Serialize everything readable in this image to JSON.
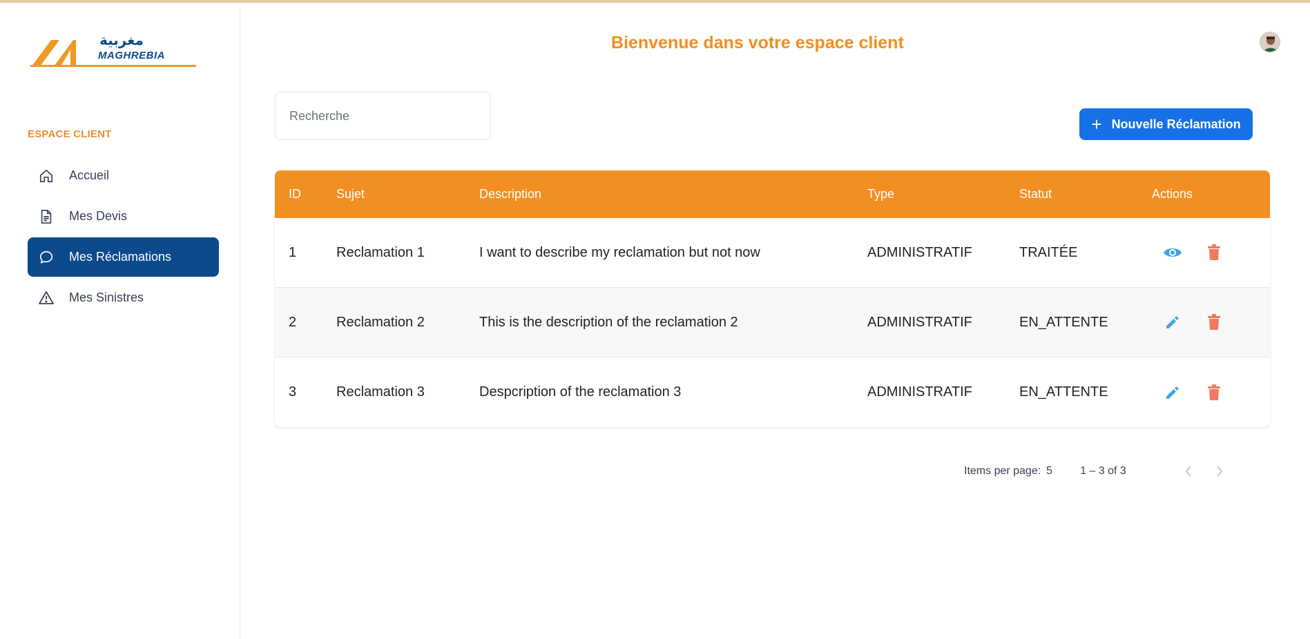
{
  "app": {
    "logo_arabic": "مغربية",
    "logo_text": "MAGHREBIA",
    "welcome": "Bienvenue dans votre espace client"
  },
  "sidebar": {
    "section_label": "ESPACE CLIENT",
    "items": [
      {
        "label": "Accueil",
        "icon": "home-icon",
        "active": false
      },
      {
        "label": "Mes Devis",
        "icon": "document-icon",
        "active": false
      },
      {
        "label": "Mes Réclamations",
        "icon": "chat-bubble-icon",
        "active": true
      },
      {
        "label": "Mes Sinistres",
        "icon": "warning-icon",
        "active": false
      }
    ]
  },
  "search": {
    "placeholder": "Recherche",
    "value": ""
  },
  "toolbar": {
    "new_label": "Nouvelle Réclamation"
  },
  "table": {
    "headers": [
      "ID",
      "Sujet",
      "Description",
      "Type",
      "Statut",
      "Actions"
    ],
    "rows": [
      {
        "id": "1",
        "sujet": "Reclamation 1",
        "description": "I want to describe my reclamation but not now",
        "type": "ADMINISTRATIF",
        "statut": "TRAITÉE",
        "primary_action": "eye-icon"
      },
      {
        "id": "2",
        "sujet": "Reclamation 2",
        "description": "This is the description of the reclamation 2",
        "type": "ADMINISTRATIF",
        "statut": "EN_ATTENTE",
        "primary_action": "pencil-icon"
      },
      {
        "id": "3",
        "sujet": "Reclamation 3",
        "description": "Despcription of the reclamation 3",
        "type": "ADMINISTRATIF",
        "statut": "EN_ATTENTE",
        "primary_action": "pencil-icon"
      }
    ]
  },
  "pagination": {
    "items_per_page_label": "Items per page:",
    "items_per_page": "5",
    "range": "1 – 3 of 3"
  },
  "colors": {
    "accent": "#ee8f22",
    "primary": "#1771e6",
    "sidebar_active": "#0b4a8b",
    "action_blue": "#3ea6e0",
    "delete_red": "#ef7a5d"
  }
}
